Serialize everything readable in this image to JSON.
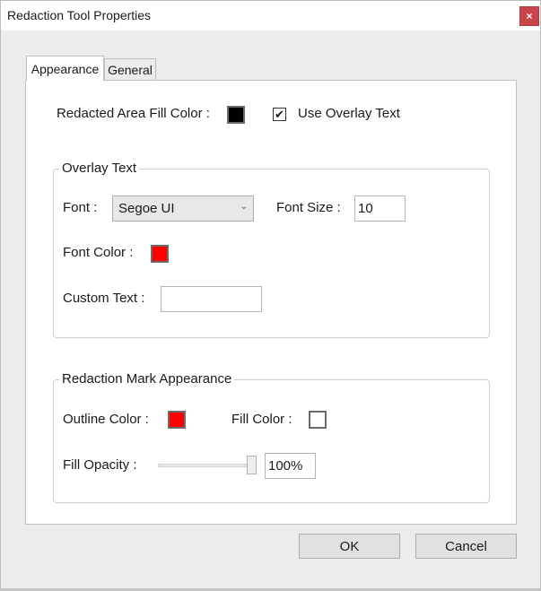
{
  "window": {
    "title": "Redaction Tool Properties",
    "close_label": "×"
  },
  "tabs": [
    {
      "label": "Appearance",
      "active": true
    },
    {
      "label": "General",
      "active": false
    }
  ],
  "appearance": {
    "fill_color_label": "Redacted Area Fill Color :",
    "fill_color": "#000000",
    "use_overlay_label": "Use Overlay Text",
    "use_overlay_checked": true,
    "check_glyph": "✔",
    "overlay_group": {
      "title": "Overlay Text",
      "font_label": "Font :",
      "font_value": "Segoe UI",
      "chevron": "⌄",
      "font_size_label": "Font Size :",
      "font_size_value": "10",
      "font_color_label": "Font Color :",
      "font_color": "#ff0000",
      "custom_text_label": "Custom Text :",
      "custom_text_value": ""
    },
    "mark_group": {
      "title": "Redaction Mark Appearance",
      "outline_color_label": "Outline Color :",
      "outline_color": "#ff0000",
      "fill_color_label": "Fill Color :",
      "fill_color": "#ffffff",
      "fill_opacity_label": "Fill Opacity :",
      "fill_opacity_value": "100%",
      "fill_opacity_fraction": 1.0
    }
  },
  "buttons": {
    "ok": "OK",
    "cancel": "Cancel"
  }
}
